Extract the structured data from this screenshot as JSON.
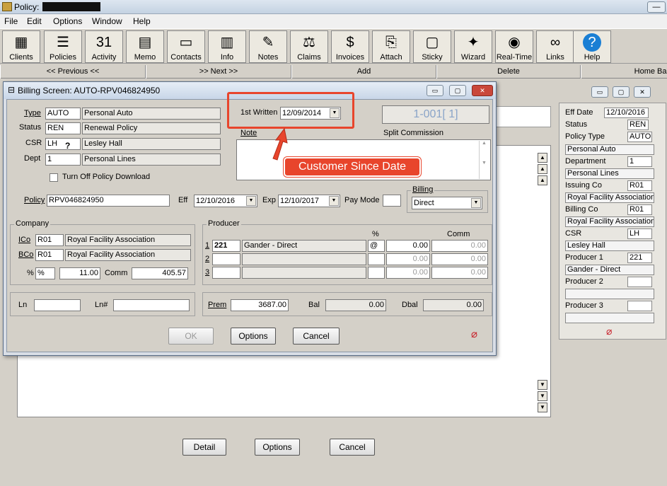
{
  "window": {
    "title": "Policy:",
    "min_glyph": "—"
  },
  "menu": [
    "File",
    "Edit",
    "Options",
    "Window",
    "Help"
  ],
  "toolbar": [
    {
      "label": "Clients",
      "icon": "clients-icon",
      "glyph": "▦"
    },
    {
      "label": "Policies",
      "icon": "policies-icon",
      "glyph": "☰"
    },
    {
      "label": "Activity",
      "icon": "calendar-icon",
      "glyph": "31"
    },
    {
      "label": "Memo",
      "icon": "memo-icon",
      "glyph": "▤"
    },
    {
      "label": "Contacts",
      "icon": "contacts-icon",
      "glyph": "▭"
    },
    {
      "label": "Info",
      "icon": "info-icon",
      "glyph": "▥"
    },
    {
      "label": "Notes",
      "icon": "notes-icon",
      "glyph": "✎"
    },
    {
      "label": "Claims",
      "icon": "claims-icon",
      "glyph": "⚖"
    },
    {
      "label": "Invoices",
      "icon": "invoices-icon",
      "glyph": "$"
    },
    {
      "label": "Attach",
      "icon": "attach-icon",
      "glyph": "⎘"
    },
    {
      "label": "Sticky",
      "icon": "sticky-icon",
      "glyph": "▢"
    },
    {
      "label": "Wizard",
      "icon": "wizard-icon",
      "glyph": "✦"
    },
    {
      "label": "Real-Time",
      "icon": "realtime-icon",
      "glyph": "◉"
    },
    {
      "label": "Links",
      "icon": "links-icon",
      "glyph": "∞"
    },
    {
      "label": "Help",
      "icon": "help-icon",
      "glyph": "?"
    }
  ],
  "nav": {
    "previous": "<< Previous <<",
    "next": ">> Next >>",
    "add": "Add",
    "delete": "Delete",
    "home": "Home Bas"
  },
  "bottom_buttons": {
    "detail": "Detail",
    "options": "Options",
    "cancel": "Cancel"
  },
  "right_panel": {
    "eff_date_label": "Eff Date",
    "eff_date": "12/10/2016",
    "status_label": "Status",
    "status": "REN",
    "policy_type_label": "Policy Type",
    "policy_type": "AUTO",
    "policy_type_desc": "Personal Auto",
    "department_label": "Department",
    "department": "1",
    "department_desc": "Personal Lines",
    "issuing_co_label": "Issuing Co",
    "issuing_co": "R01",
    "issuing_co_desc": "Royal Facility Association",
    "billing_co_label": "Billing Co",
    "billing_co": "R01",
    "billing_co_desc": "Royal Facility Association",
    "csr_label": "CSR",
    "csr": "LH",
    "csr_desc": "Lesley Hall",
    "producer1_label": "Producer 1",
    "producer1": "221",
    "producer1_desc": "Gander - Direct",
    "producer2_label": "Producer 2",
    "producer3_label": "Producer 3"
  },
  "dialog": {
    "title": "Billing Screen: AUTO-RPV046824950",
    "type_label": "Type",
    "type_code": "AUTO",
    "type_desc": "Personal Auto",
    "status_label": "Status",
    "status_code": "REN",
    "status_desc": "Renewal Policy",
    "csr_label": "CSR",
    "csr_code": "LH",
    "csr_desc": "Lesley Hall",
    "dept_label": "Dept",
    "dept_code": "1",
    "dept_desc": "Personal Lines",
    "first_written_label": "1st Written",
    "first_written": "12/09/2014",
    "code_display": "1-001[ 1]",
    "note_label": "Note",
    "split_commission": "Split Commission",
    "turn_off_download": "Turn Off Policy Download",
    "policy_label": "Policy",
    "policy_number": "RPV046824950",
    "eff_label": "Eff",
    "eff_date": "12/10/2016",
    "exp_label": "Exp",
    "exp_date": "12/10/2017",
    "pay_mode_label": "Pay Mode",
    "billing_label": "Billing",
    "billing_value": "Direct",
    "company_label": "Company",
    "ico_label": "ICo",
    "ico_code": "R01",
    "ico_desc": "Royal Facility Association",
    "bco_label": "BCo",
    "bco_code": "R01",
    "bco_desc": "Royal Facility Association",
    "pct_label": "%",
    "pct_value": "%",
    "comm_pct": "11.00",
    "comm_label": "Comm",
    "comm_amount": "405.57",
    "producer_label": "Producer",
    "pct_header": "%",
    "comm_header": "Comm",
    "producers": [
      {
        "num": "1",
        "code": "221",
        "name": "Gander - Direct",
        "pct": "@",
        "share": "0.00",
        "comm": "0.00"
      },
      {
        "num": "2",
        "code": "",
        "name": "",
        "pct": "",
        "share": "0.00",
        "comm": "0.00"
      },
      {
        "num": "3",
        "code": "",
        "name": "",
        "pct": "",
        "share": "0.00",
        "comm": "0.00"
      }
    ],
    "ln_label": "Ln",
    "lnnum_label": "Ln#",
    "prem_label": "Prem",
    "prem": "3687.00",
    "bal_label": "Bal",
    "bal": "0.00",
    "dbal_label": "Dbal",
    "dbal": "0.00",
    "ok": "OK",
    "options": "Options",
    "cancel": "Cancel"
  },
  "annotation": {
    "text": "Customer Since Date",
    "color": "#e8452c"
  }
}
